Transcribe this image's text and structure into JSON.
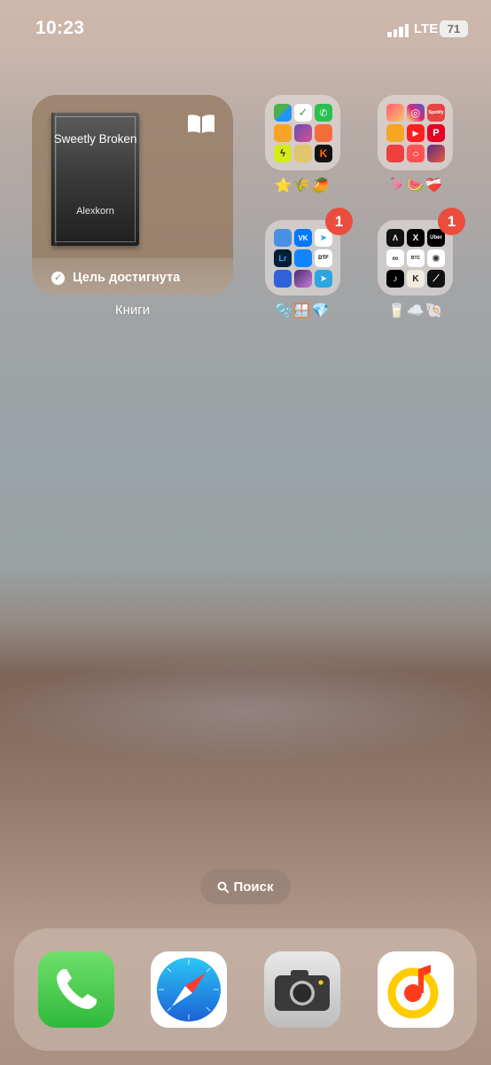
{
  "status_bar": {
    "time": "10:23",
    "network": "LTE",
    "battery": "71"
  },
  "books_widget": {
    "book_title": "Sweetly Broken",
    "book_author": "Alexkorn",
    "goal_text": "Цель достигнута",
    "label": "Книги",
    "icon": "open-book-icon"
  },
  "folders": [
    {
      "id": "folder-1",
      "label": "⭐🌾🥭",
      "badge": ""
    },
    {
      "id": "folder-2",
      "label": "🦩🍉❤️‍🩹",
      "badge": ""
    },
    {
      "id": "folder-3",
      "label": "🫧🪟💎",
      "badge": "1"
    },
    {
      "id": "folder-4",
      "label": "🥛☁️🐚",
      "badge": "1"
    }
  ],
  "folder_apps": {
    "folder_1": [
      "Maps",
      "TickTick",
      "WhatsApp",
      "Books",
      "Photos",
      "Mail",
      "Bolt",
      "Game",
      "Kinopoisk"
    ],
    "folder_2": [
      "Tinder",
      "Instagram",
      "Spotify",
      "Ozon",
      "YouTube",
      "Pinterest",
      "Samokat",
      "Vkusvill",
      "Game"
    ],
    "folder_3": [
      "Notes",
      "VK",
      "Telegram",
      "Lightroom",
      "Bluesky",
      "DTF",
      "Pages",
      "Game",
      "Telegram X"
    ],
    "folder_4": [
      "Aspect",
      "X",
      "Uber",
      "Link",
      "BTC",
      "Camera",
      "TikTok",
      "K",
      "Strava"
    ]
  },
  "mini_icon_text": {
    "vk": "VK",
    "lr": "Lr",
    "dtf": "DTF",
    "x": "X",
    "uber": "Uber",
    "btc": "BTC",
    "k": "K",
    "spotify": "Spotify"
  },
  "search": {
    "label": "Поиск",
    "icon": "search-icon"
  },
  "dock": [
    {
      "name": "phone",
      "icon": "phone-icon",
      "color": "#34C759"
    },
    {
      "name": "safari",
      "icon": "compass-icon",
      "color": "#1E88E5"
    },
    {
      "name": "camera",
      "icon": "camera-icon",
      "color": "#BDBDBD"
    },
    {
      "name": "yandex-music",
      "icon": "music-note-icon",
      "color": "#FFCC00"
    }
  ]
}
